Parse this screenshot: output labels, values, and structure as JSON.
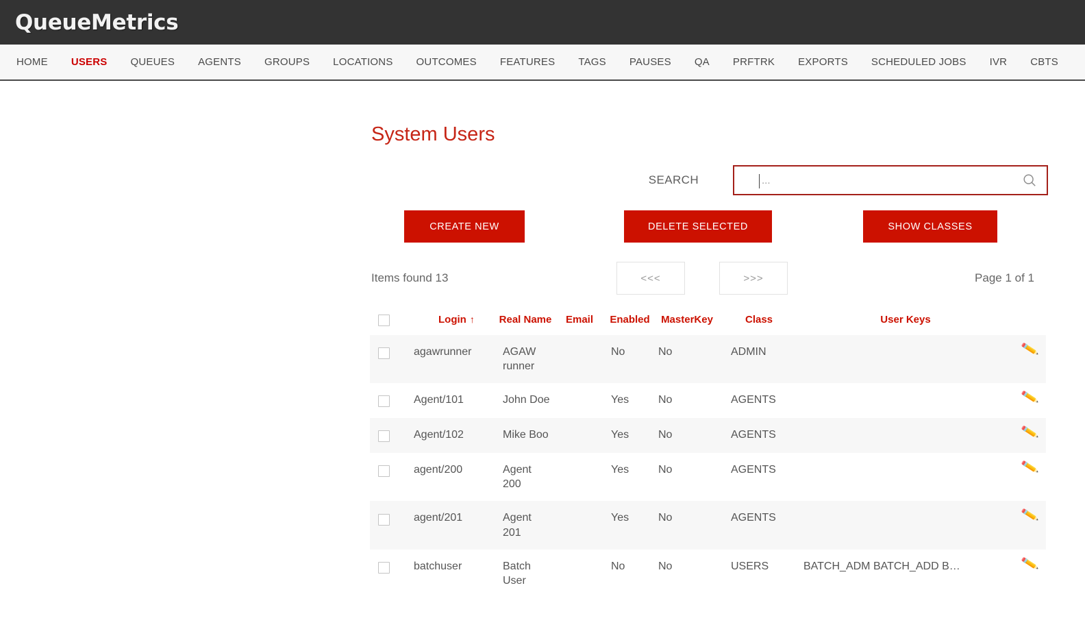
{
  "brand": {
    "logo_text": "QueueMetrics"
  },
  "nav": {
    "items": [
      {
        "label": "HOME",
        "active": false
      },
      {
        "label": "USERS",
        "active": true
      },
      {
        "label": "QUEUES",
        "active": false
      },
      {
        "label": "AGENTS",
        "active": false
      },
      {
        "label": "GROUPS",
        "active": false
      },
      {
        "label": "LOCATIONS",
        "active": false
      },
      {
        "label": "OUTCOMES",
        "active": false
      },
      {
        "label": "FEATURES",
        "active": false
      },
      {
        "label": "TAGS",
        "active": false
      },
      {
        "label": "PAUSES",
        "active": false
      },
      {
        "label": "QA",
        "active": false
      },
      {
        "label": "PRFTRK",
        "active": false
      },
      {
        "label": "EXPORTS",
        "active": false
      },
      {
        "label": "SCHEDULED JOBS",
        "active": false
      },
      {
        "label": "IVR",
        "active": false
      },
      {
        "label": "CBTS",
        "active": false
      }
    ]
  },
  "page": {
    "title": "System Users"
  },
  "search": {
    "label": "SEARCH",
    "value": "",
    "placeholder": "...",
    "icon": "search-icon"
  },
  "actions": {
    "create_new": "CREATE NEW",
    "delete_selected": "DELETE SELECTED",
    "show_classes": "SHOW CLASSES"
  },
  "pager": {
    "items_found": "Items found 13",
    "prev_label": "<<<",
    "next_label": ">>>",
    "page_of": "Page 1 of 1"
  },
  "table": {
    "columns": [
      {
        "key": "check",
        "label": ""
      },
      {
        "key": "login",
        "label": "Login",
        "sort": "↑"
      },
      {
        "key": "real",
        "label": "Real Name"
      },
      {
        "key": "email",
        "label": "Email"
      },
      {
        "key": "enabled",
        "label": "Enabled"
      },
      {
        "key": "master",
        "label": "MasterKey"
      },
      {
        "key": "class",
        "label": "Class"
      },
      {
        "key": "keys",
        "label": "User Keys"
      },
      {
        "key": "edit",
        "label": ""
      }
    ],
    "rows": [
      {
        "login": "agawrunner",
        "real_name": "AGAW runner",
        "email": "",
        "enabled": "No",
        "masterkey": "No",
        "class": "ADMIN",
        "user_keys": "",
        "edit_icon": "pencil-icon"
      },
      {
        "login": "Agent/101",
        "real_name": "John Doe",
        "email": "",
        "enabled": "Yes",
        "masterkey": "No",
        "class": "AGENTS",
        "user_keys": "",
        "edit_icon": "pencil-icon"
      },
      {
        "login": "Agent/102",
        "real_name": "Mike Boo",
        "email": "",
        "enabled": "Yes",
        "masterkey": "No",
        "class": "AGENTS",
        "user_keys": "",
        "edit_icon": "pencil-icon"
      },
      {
        "login": "agent/200",
        "real_name": "Agent 200",
        "email": "",
        "enabled": "Yes",
        "masterkey": "No",
        "class": "AGENTS",
        "user_keys": "",
        "edit_icon": "pencil-icon"
      },
      {
        "login": "agent/201",
        "real_name": "Agent 201",
        "email": "",
        "enabled": "Yes",
        "masterkey": "No",
        "class": "AGENTS",
        "user_keys": "",
        "edit_icon": "pencil-icon"
      },
      {
        "login": "batchuser",
        "real_name": "Batch User",
        "email": "",
        "enabled": "No",
        "masterkey": "No",
        "class": "USERS",
        "user_keys": "BATCH_ADM BATCH_ADD B…",
        "edit_icon": "pencil-icon"
      }
    ]
  },
  "colors": {
    "brand_bar": "#333333",
    "accent_red": "#cc1100",
    "title_red": "#c62516",
    "row_alt": "#f7f7f7",
    "text_gray": "#555555"
  }
}
